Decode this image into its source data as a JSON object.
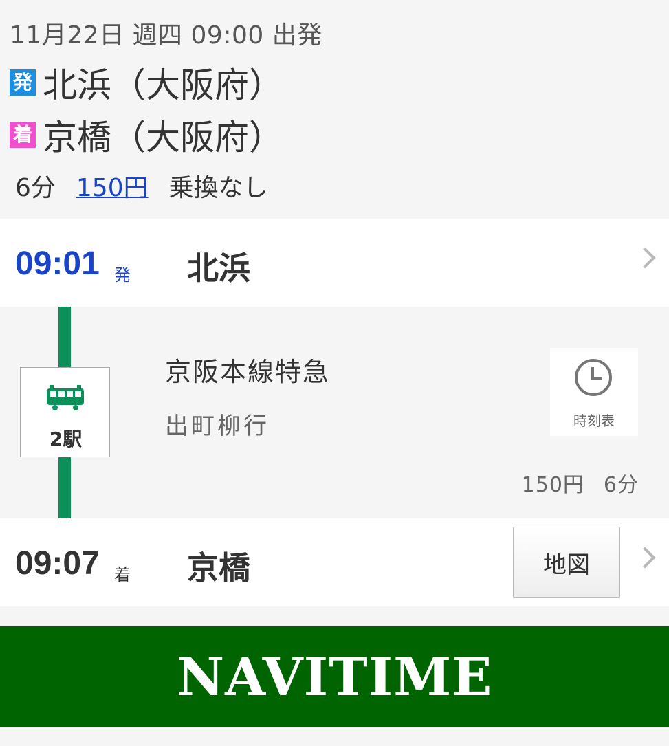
{
  "header": {
    "datetime": "11月22日 週四 09:00 出発",
    "from_badge": "発",
    "from_station": "北浜（大阪府）",
    "to_badge": "着",
    "to_station": "京橋（大阪府）",
    "duration": "6分",
    "fare": "150円",
    "transfers": "乗換なし"
  },
  "departure": {
    "time": "09:01",
    "suffix": "発",
    "station": "北浜"
  },
  "segment": {
    "stops": "2駅",
    "line_name": "京阪本線特急",
    "direction": "出町柳行",
    "timetable_label": "時刻表",
    "fare": "150円",
    "duration": "6分",
    "line_color": "#0d8f5a"
  },
  "arrival": {
    "time": "09:07",
    "suffix": "着",
    "station": "京橋",
    "map_label": "地図"
  },
  "banner": {
    "logo": "NAVITIME",
    "color": "#006400"
  },
  "colors": {
    "accent": "#1a44c8",
    "departure_badge": "#1e8fe0",
    "arrival_badge": "#f24fcf"
  }
}
